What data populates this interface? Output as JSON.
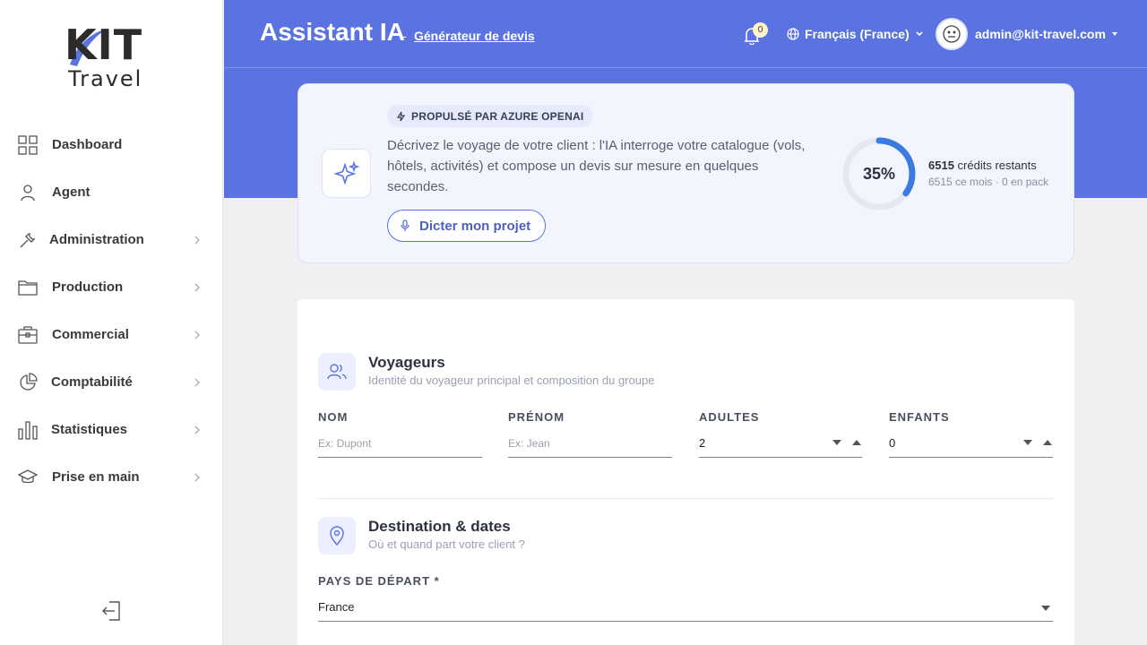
{
  "brand": {
    "kit": "KIT",
    "travel": "Travel"
  },
  "sidebar": {
    "items": [
      {
        "label": "Dashboard",
        "icon": "grid-icon",
        "has_children": false
      },
      {
        "label": "Agent",
        "icon": "user-icon",
        "has_children": false
      },
      {
        "label": "Administration",
        "icon": "wrench-icon",
        "has_children": true
      },
      {
        "label": "Production",
        "icon": "folder-icon",
        "has_children": true
      },
      {
        "label": "Commercial",
        "icon": "briefcase-icon",
        "has_children": true
      },
      {
        "label": "Comptabilité",
        "icon": "pie-chart-icon",
        "has_children": true
      },
      {
        "label": "Statistiques",
        "icon": "bar-chart-icon",
        "has_children": true
      },
      {
        "label": "Prise en main",
        "icon": "graduation-cap-icon",
        "has_children": true
      }
    ]
  },
  "header": {
    "title": "Assistant IA",
    "separator": "-",
    "subtitle": "Générateur de devis",
    "notifications_count": "0",
    "language": "Français (France)",
    "user_email": "admin@kit-travel.com"
  },
  "ai_card": {
    "powered_by": "PROPULSÉ PAR AZURE OPENAI",
    "description": "Décrivez le voyage de votre client : l'IA interroge votre catalogue (vols, hôtels, activités) et compose un devis sur mesure en quelques secondes.",
    "dictate_button": "Dicter mon projet",
    "usage_percent": 35,
    "usage_label": "35%",
    "credits_value": "6515",
    "credits_label": "crédits restants",
    "credits_detail": "6515 ce mois · 0 en pack",
    "accent_color": "#3b7be0"
  },
  "form": {
    "travelers": {
      "title": "Voyageurs",
      "subtitle": "Identité du voyageur principal et composition du groupe",
      "fields": {
        "nom": {
          "label": "NOM",
          "placeholder": "Ex: Dupont",
          "value": ""
        },
        "prenom": {
          "label": "PRÉNOM",
          "placeholder": "Ex: Jean",
          "value": ""
        },
        "adultes": {
          "label": "ADULTES",
          "value": "2"
        },
        "enfants": {
          "label": "ENFANTS",
          "value": "0"
        }
      }
    },
    "destination": {
      "title": "Destination & dates",
      "subtitle": "Où et quand part votre client ?",
      "fields": {
        "pays_depart": {
          "label": "PAYS DE DÉPART *",
          "value": "France"
        }
      }
    }
  },
  "colors": {
    "primary": "#5a73e1",
    "sidebar_bg": "#ffffff",
    "page_bg": "#f0f0f2"
  }
}
